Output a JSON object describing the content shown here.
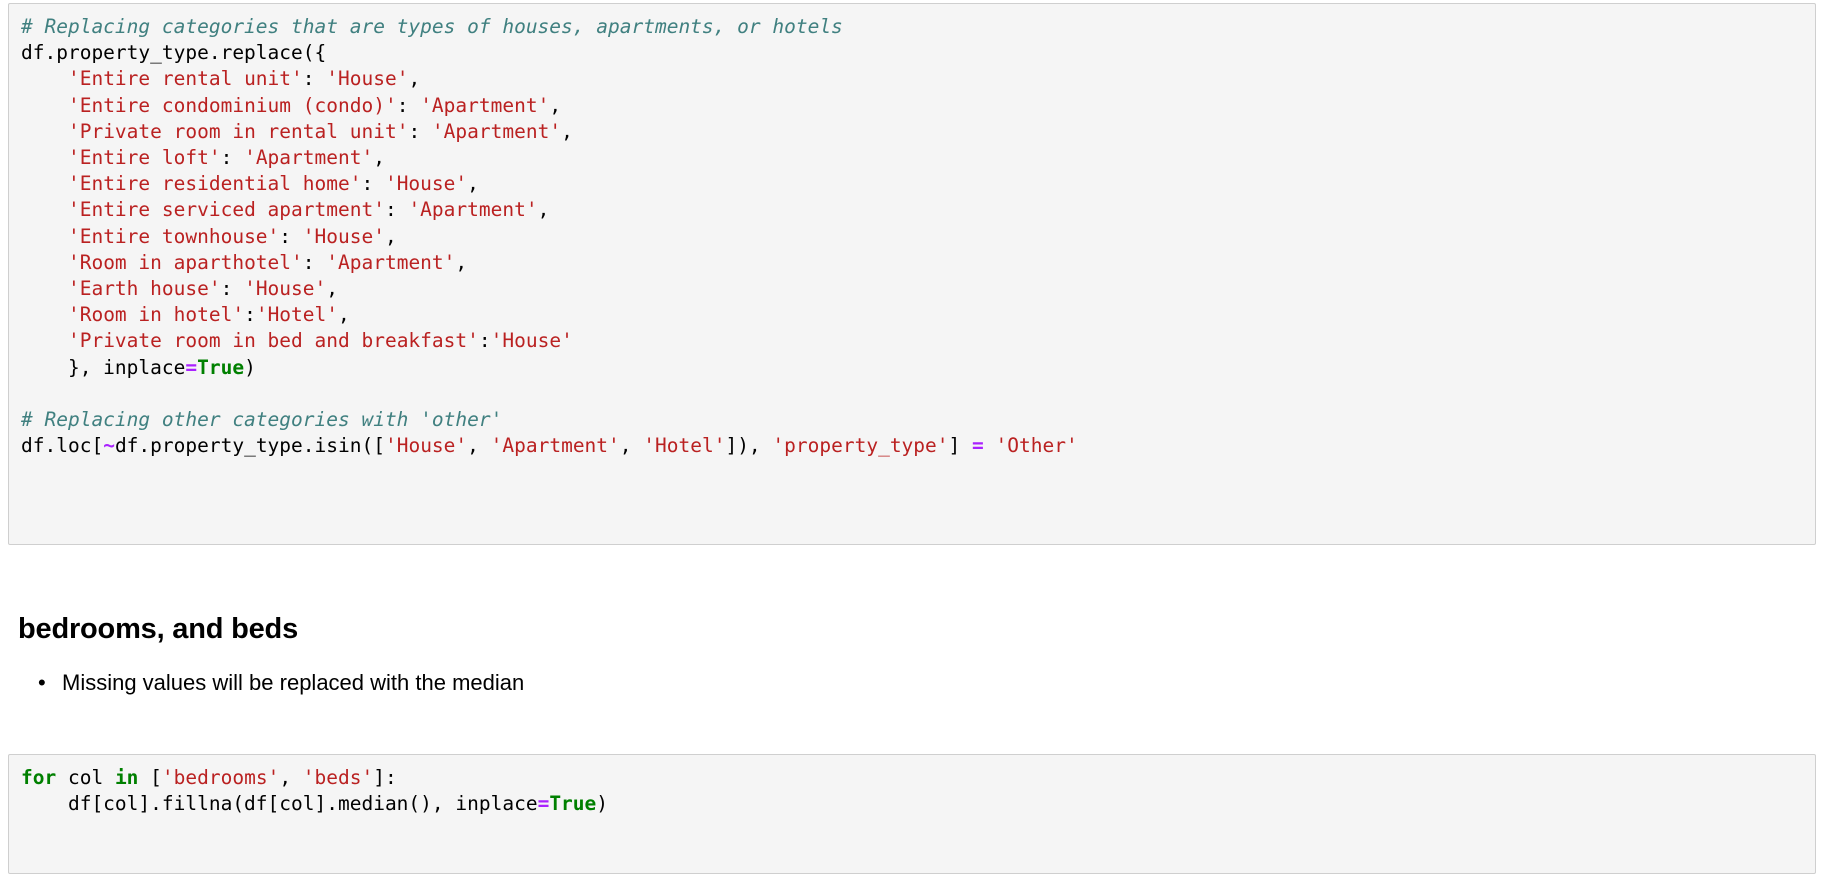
{
  "code_block_1": {
    "language": "python",
    "lines": [
      {
        "segments": [
          {
            "t": "comment",
            "v": "# Replacing categories that are types of houses, apartments, or hotels"
          }
        ]
      },
      {
        "segments": [
          {
            "t": "plain",
            "v": "df.property_type.replace({"
          }
        ]
      },
      {
        "segments": [
          {
            "t": "plain",
            "v": "    "
          },
          {
            "t": "string",
            "v": "'Entire rental unit'"
          },
          {
            "t": "plain",
            "v": ": "
          },
          {
            "t": "string",
            "v": "'House'"
          },
          {
            "t": "plain",
            "v": ","
          }
        ]
      },
      {
        "segments": [
          {
            "t": "plain",
            "v": "    "
          },
          {
            "t": "string",
            "v": "'Entire condominium (condo)'"
          },
          {
            "t": "plain",
            "v": ": "
          },
          {
            "t": "string",
            "v": "'Apartment'"
          },
          {
            "t": "plain",
            "v": ","
          }
        ]
      },
      {
        "segments": [
          {
            "t": "plain",
            "v": "    "
          },
          {
            "t": "string",
            "v": "'Private room in rental unit'"
          },
          {
            "t": "plain",
            "v": ": "
          },
          {
            "t": "string",
            "v": "'Apartment'"
          },
          {
            "t": "plain",
            "v": ","
          }
        ]
      },
      {
        "segments": [
          {
            "t": "plain",
            "v": "    "
          },
          {
            "t": "string",
            "v": "'Entire loft'"
          },
          {
            "t": "plain",
            "v": ": "
          },
          {
            "t": "string",
            "v": "'Apartment'"
          },
          {
            "t": "plain",
            "v": ","
          }
        ]
      },
      {
        "segments": [
          {
            "t": "plain",
            "v": "    "
          },
          {
            "t": "string",
            "v": "'Entire residential home'"
          },
          {
            "t": "plain",
            "v": ": "
          },
          {
            "t": "string",
            "v": "'House'"
          },
          {
            "t": "plain",
            "v": ","
          }
        ]
      },
      {
        "segments": [
          {
            "t": "plain",
            "v": "    "
          },
          {
            "t": "string",
            "v": "'Entire serviced apartment'"
          },
          {
            "t": "plain",
            "v": ": "
          },
          {
            "t": "string",
            "v": "'Apartment'"
          },
          {
            "t": "plain",
            "v": ","
          }
        ]
      },
      {
        "segments": [
          {
            "t": "plain",
            "v": "    "
          },
          {
            "t": "string",
            "v": "'Entire townhouse'"
          },
          {
            "t": "plain",
            "v": ": "
          },
          {
            "t": "string",
            "v": "'House'"
          },
          {
            "t": "plain",
            "v": ","
          }
        ]
      },
      {
        "segments": [
          {
            "t": "plain",
            "v": "    "
          },
          {
            "t": "string",
            "v": "'Room in aparthotel'"
          },
          {
            "t": "plain",
            "v": ": "
          },
          {
            "t": "string",
            "v": "'Apartment'"
          },
          {
            "t": "plain",
            "v": ","
          }
        ]
      },
      {
        "segments": [
          {
            "t": "plain",
            "v": "    "
          },
          {
            "t": "string",
            "v": "'Earth house'"
          },
          {
            "t": "plain",
            "v": ": "
          },
          {
            "t": "string",
            "v": "'House'"
          },
          {
            "t": "plain",
            "v": ","
          }
        ]
      },
      {
        "segments": [
          {
            "t": "plain",
            "v": "    "
          },
          {
            "t": "string",
            "v": "'Room in hotel'"
          },
          {
            "t": "plain",
            "v": ":"
          },
          {
            "t": "string",
            "v": "'Hotel'"
          },
          {
            "t": "plain",
            "v": ","
          }
        ]
      },
      {
        "segments": [
          {
            "t": "plain",
            "v": "    "
          },
          {
            "t": "string",
            "v": "'Private room in bed and breakfast'"
          },
          {
            "t": "plain",
            "v": ":"
          },
          {
            "t": "string",
            "v": "'House'"
          }
        ]
      },
      {
        "segments": [
          {
            "t": "plain",
            "v": "    }, inplace"
          },
          {
            "t": "operator",
            "v": "="
          },
          {
            "t": "keyword-constant",
            "v": "True"
          },
          {
            "t": "plain",
            "v": ")"
          }
        ]
      },
      {
        "segments": [
          {
            "t": "plain",
            "v": ""
          }
        ]
      },
      {
        "segments": [
          {
            "t": "comment",
            "v": "# Replacing other categories with 'other'"
          }
        ]
      },
      {
        "segments": [
          {
            "t": "plain",
            "v": "df.loc["
          },
          {
            "t": "operator",
            "v": "~"
          },
          {
            "t": "plain",
            "v": "df.property_type.isin(["
          },
          {
            "t": "string",
            "v": "'House'"
          },
          {
            "t": "plain",
            "v": ", "
          },
          {
            "t": "string",
            "v": "'Apartment'"
          },
          {
            "t": "plain",
            "v": ", "
          },
          {
            "t": "string",
            "v": "'Hotel'"
          },
          {
            "t": "plain",
            "v": "]), "
          },
          {
            "t": "string",
            "v": "'property_type'"
          },
          {
            "t": "plain",
            "v": "] "
          },
          {
            "t": "operator",
            "v": "="
          },
          {
            "t": "plain",
            "v": " "
          },
          {
            "t": "string",
            "v": "'Other'"
          }
        ]
      }
    ]
  },
  "section": {
    "heading": "bedrooms, and beds",
    "bullets": [
      "Missing values will be replaced with the median"
    ]
  },
  "code_block_2": {
    "language": "python",
    "lines": [
      {
        "segments": [
          {
            "t": "keyword",
            "v": "for"
          },
          {
            "t": "plain",
            "v": " col "
          },
          {
            "t": "keyword",
            "v": "in"
          },
          {
            "t": "plain",
            "v": " ["
          },
          {
            "t": "string",
            "v": "'bedrooms'"
          },
          {
            "t": "plain",
            "v": ", "
          },
          {
            "t": "string",
            "v": "'beds'"
          },
          {
            "t": "plain",
            "v": "]:"
          }
        ]
      },
      {
        "segments": [
          {
            "t": "plain",
            "v": "    df[col].fillna(df[col].median(), inplace"
          },
          {
            "t": "operator",
            "v": "="
          },
          {
            "t": "keyword-constant",
            "v": "True"
          },
          {
            "t": "plain",
            "v": ")"
          }
        ]
      }
    ]
  },
  "colors": {
    "code_background": "#f5f5f5",
    "code_border": "#cfcfcf",
    "page_background": "#ffffff",
    "comment": "#408080",
    "string": "#ba2121",
    "keyword": "#008000",
    "operator": "#aa22ff",
    "text": "#000000"
  }
}
